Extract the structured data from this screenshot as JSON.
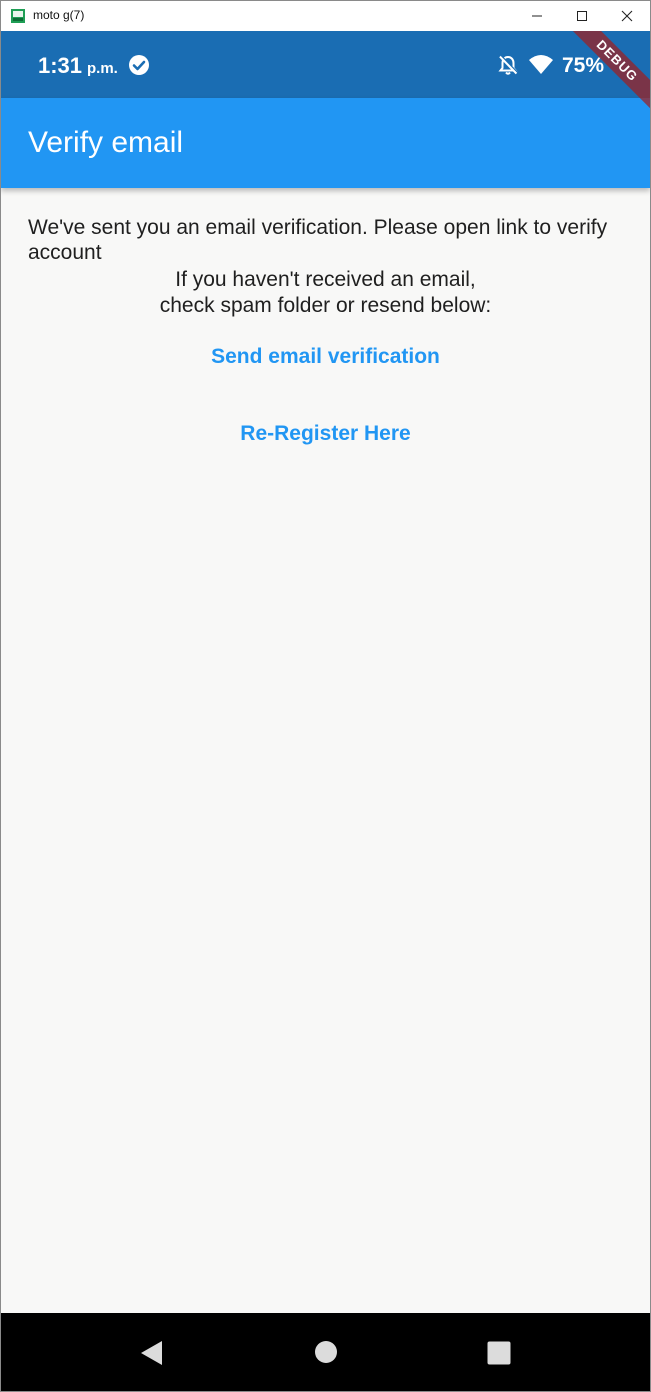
{
  "window": {
    "title": "moto g(7)"
  },
  "statusbar": {
    "time": "1:31",
    "time_suffix": "p.m.",
    "battery_percent": "75%"
  },
  "debug_banner": "DEBUG",
  "appbar": {
    "title": "Verify email"
  },
  "main": {
    "message_line1": "We've sent you an email verification. Please open link to verify account",
    "message_line2": "If you haven't received an email,\n check spam folder or resend below:",
    "send_button_label": "Send email verification",
    "reregister_button_label": "Re-Register Here"
  },
  "colors": {
    "status_bar": "#1a6db3",
    "app_bar": "#2196f3",
    "accent": "#2196f3",
    "background": "#f8f8f7"
  },
  "icons": {
    "status": [
      "check-circle-icon",
      "bell-off-icon",
      "wifi-icon"
    ],
    "nav": [
      "back-icon",
      "home-icon",
      "recents-icon"
    ]
  }
}
